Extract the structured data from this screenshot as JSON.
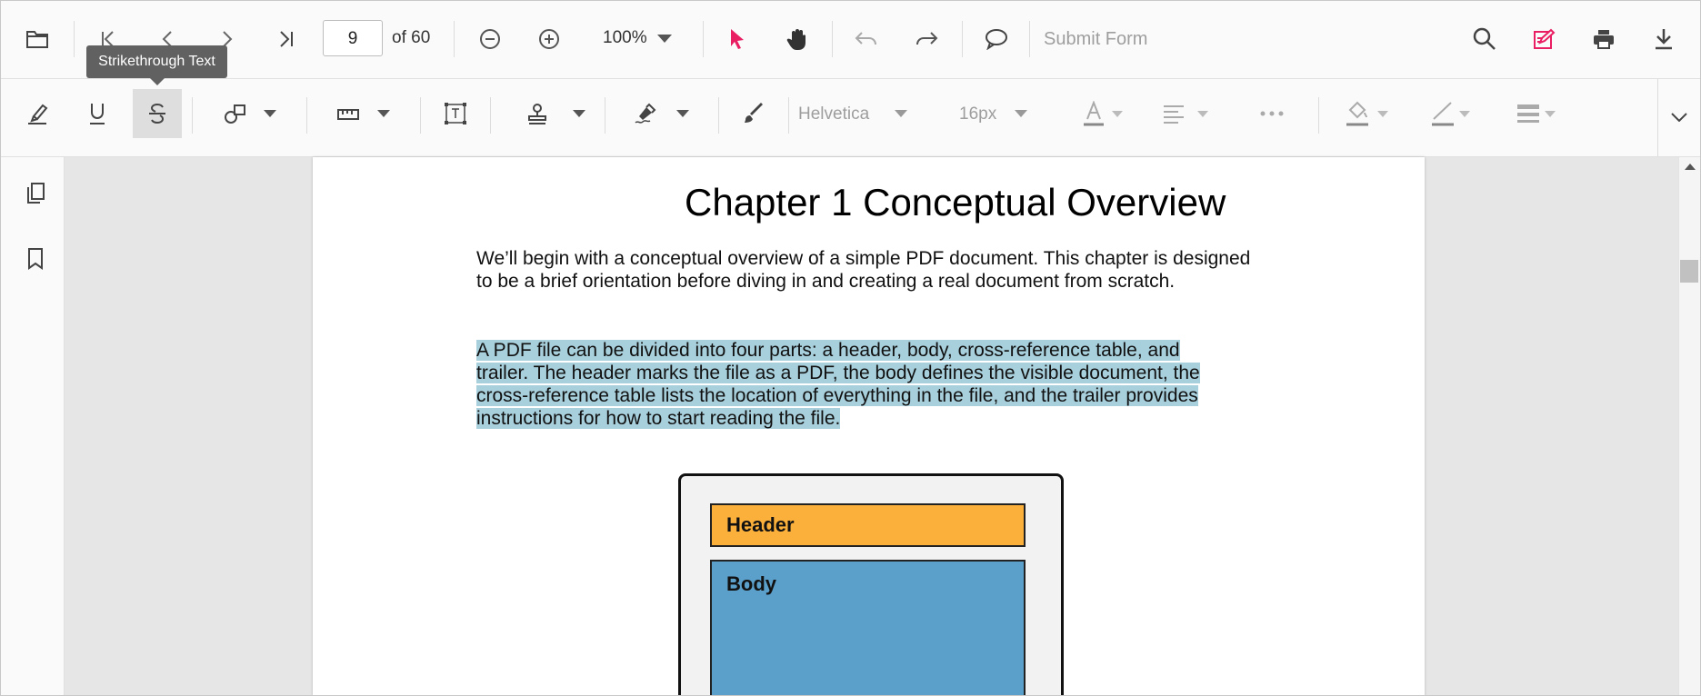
{
  "toolbar": {
    "current_page": "9",
    "page_total": "of 60",
    "zoom": "100%",
    "submit_form": "Submit Form",
    "tooltip": "Strikethrough Text",
    "accent_color": "#e91e63"
  },
  "annotation_toolbar": {
    "font_family": "Helvetica",
    "font_size": "16px"
  },
  "document": {
    "chapter_title": "Chapter 1  Conceptual Overview",
    "paragraph1": "We’ll begin with a conceptual overview of a simple PDF document. This chapter is designed to be a brief orientation before diving in and creating a real document from scratch.",
    "paragraph2_lines": [
      "A PDF file can be divided into four parts: a header, body, cross-reference table, and",
      "trailer. The header marks the file as a PDF, the body defines the visible document, the",
      "cross-reference table lists the location of everything in the file, and the trailer provides",
      "instructions for how to start reading the file."
    ],
    "diagram": {
      "header_label": "Header",
      "body_label": "Body",
      "header_color": "#fbb03b",
      "body_color": "#5b9fcb"
    },
    "highlight_color": "#a8cfdc"
  }
}
